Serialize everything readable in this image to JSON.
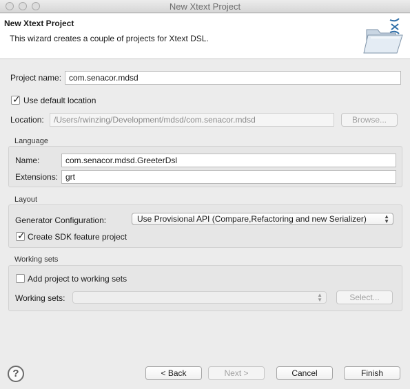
{
  "window": {
    "title": "New Xtext Project"
  },
  "banner": {
    "title": "New Xtext Project",
    "description": "This wizard creates a couple of projects for Xtext DSL.",
    "icon": "folder-wizard-icon"
  },
  "project": {
    "name_label": "Project name:",
    "name_value": "com.senacor.mdsd",
    "use_default_label": "Use default location",
    "use_default_checked": true,
    "location_label": "Location:",
    "location_value": "/Users/rwinzing/Development/mdsd/com.senacor.mdsd",
    "browse_label": "Browse..."
  },
  "language": {
    "title": "Language",
    "name_label": "Name:",
    "name_value": "com.senacor.mdsd.GreeterDsl",
    "extensions_label": "Extensions:",
    "extensions_value": "grt"
  },
  "layout": {
    "title": "Layout",
    "generator_label": "Generator Configuration:",
    "generator_value": "Use Provisional API (Compare,Refactoring and new Serializer)",
    "sdk_label": "Create SDK feature project",
    "sdk_checked": true
  },
  "working_sets": {
    "title": "Working sets",
    "add_label": "Add project to working sets",
    "add_checked": false,
    "sets_label": "Working sets:",
    "sets_value": "",
    "select_label": "Select..."
  },
  "footer": {
    "back_label": "< Back",
    "next_label": "Next >",
    "cancel_label": "Cancel",
    "finish_label": "Finish"
  }
}
